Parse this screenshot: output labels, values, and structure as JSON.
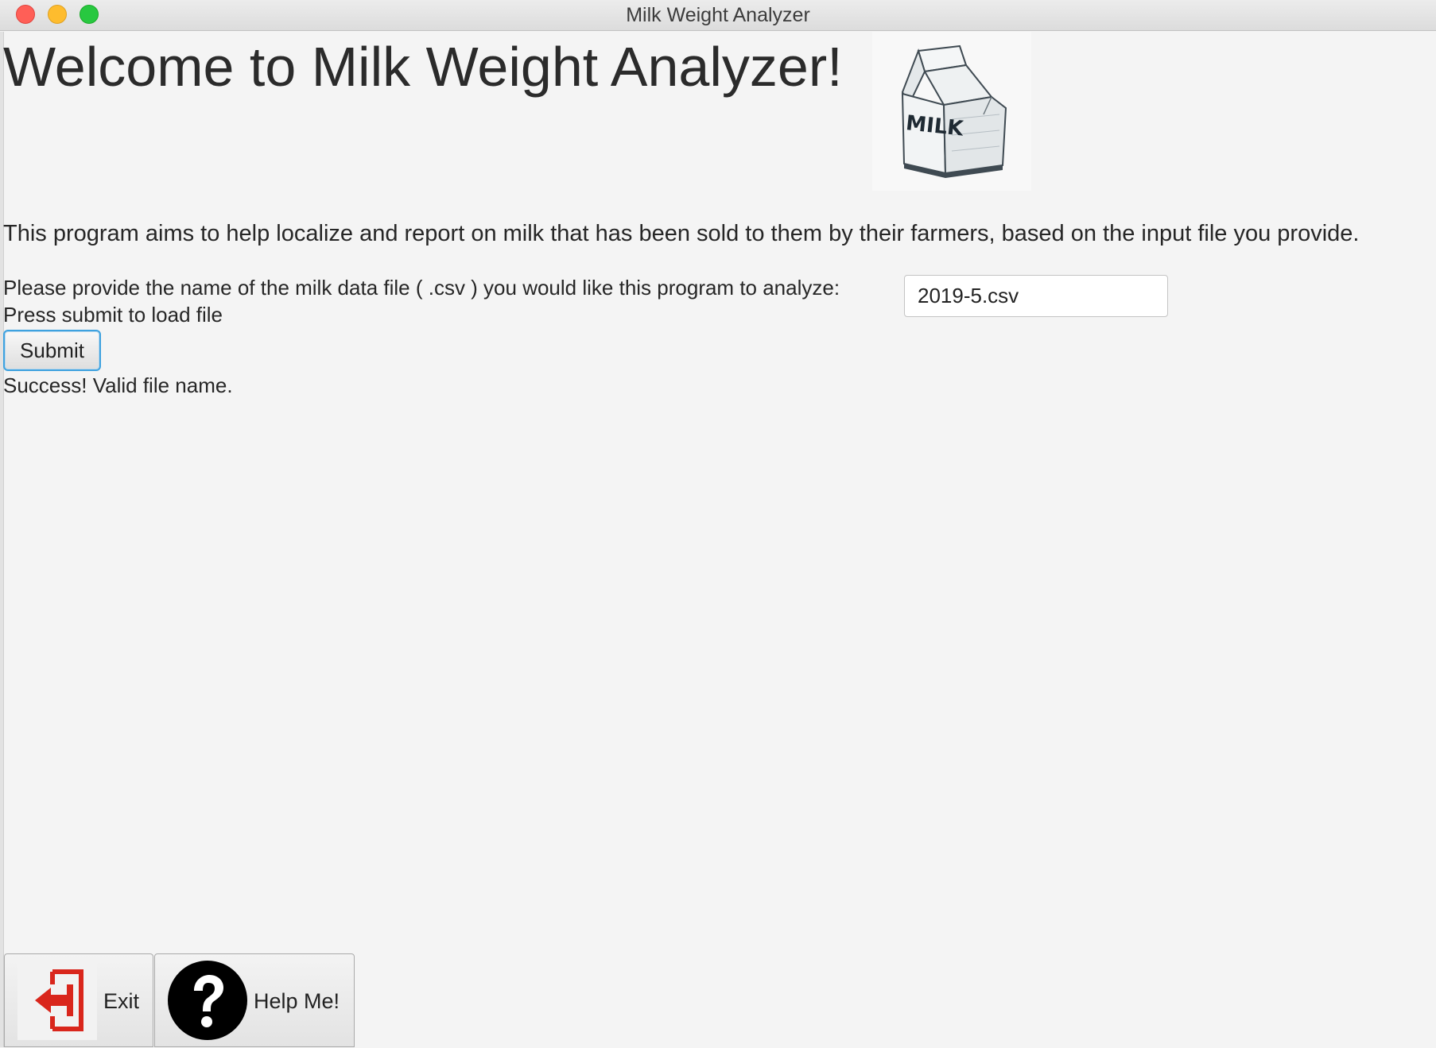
{
  "window": {
    "title": "Milk Weight Analyzer"
  },
  "main": {
    "heading": "Welcome to Milk Weight Analyzer!",
    "image_label": "MILK",
    "description": "This program aims to help localize and report on milk that has been sold to them by their farmers, based on the input file you provide.",
    "file_prompt": "Please provide the name of the milk data file ( .csv ) you would like this program to analyze:",
    "file_input_value": "2019-5.csv",
    "submit_hint": "Press submit to load file",
    "submit_label": "Submit",
    "status_message": "Success! Valid file name."
  },
  "footer": {
    "exit_label": "Exit",
    "help_label": "Help Me!"
  },
  "icons": {
    "exit": "exit-door-arrow-icon",
    "help": "question-mark-icon",
    "logo": "milk-carton-icon"
  },
  "colors": {
    "exit_icon": "#d9261c",
    "help_icon": "#000000",
    "focus_ring": "#3ea2df"
  }
}
